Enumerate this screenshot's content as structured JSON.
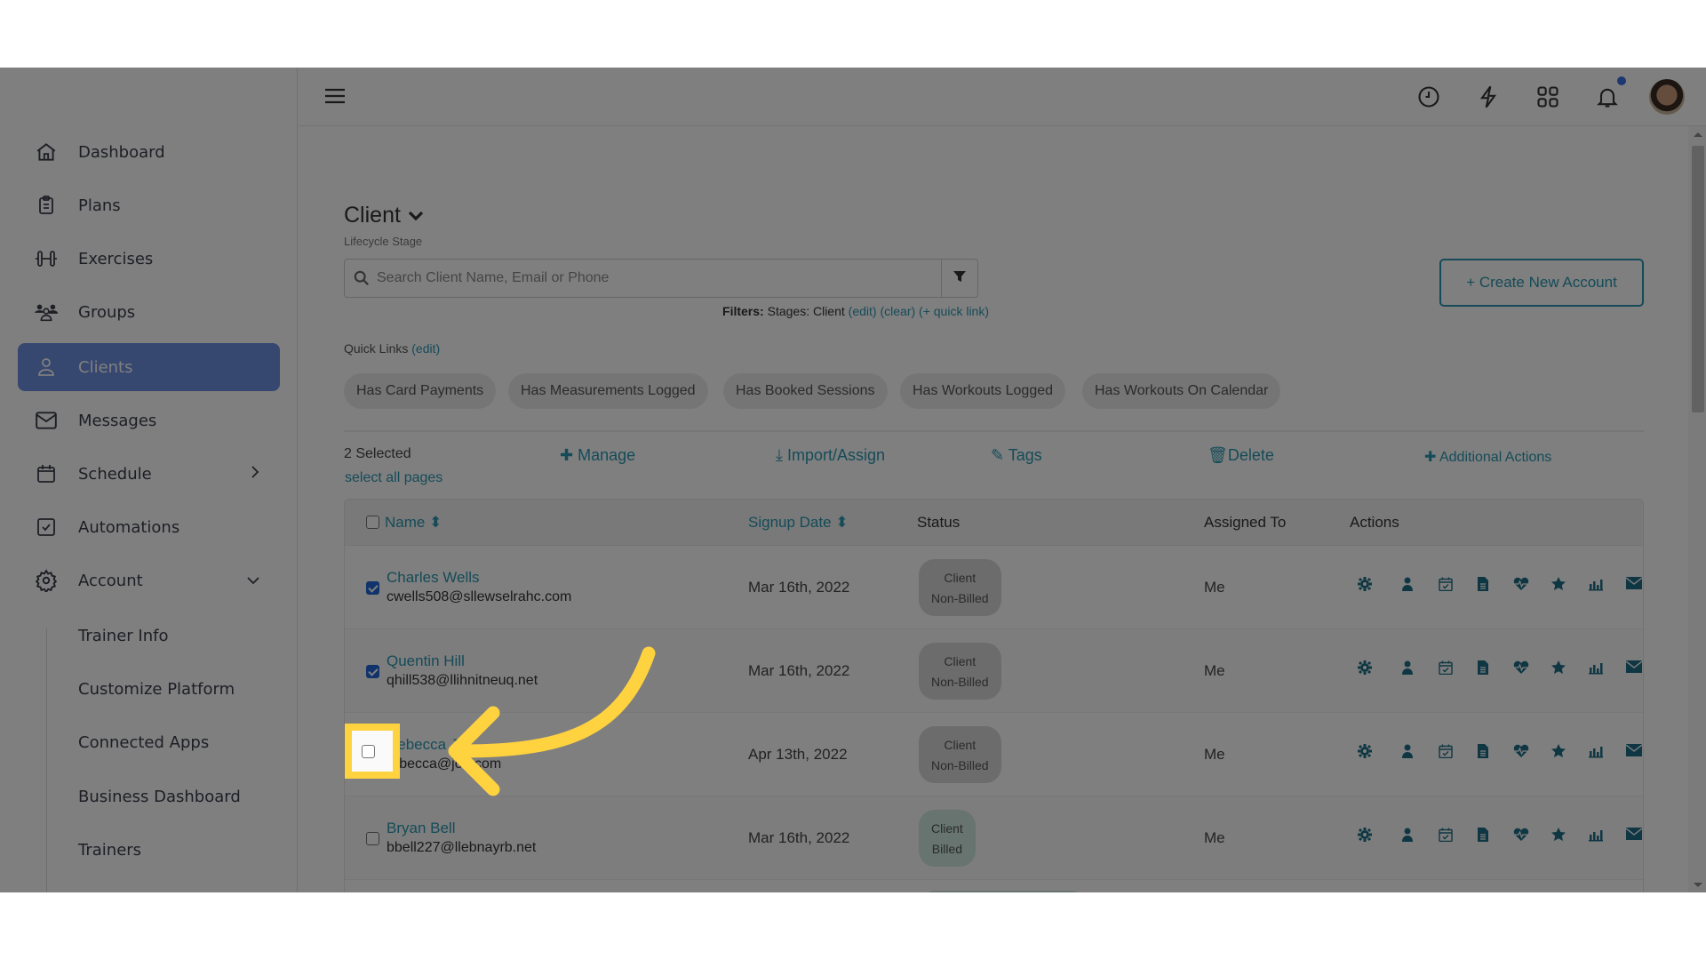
{
  "sidebar": {
    "items": [
      {
        "label": "Dashboard",
        "icon": "home-icon"
      },
      {
        "label": "Plans",
        "icon": "clipboard-icon"
      },
      {
        "label": "Exercises",
        "icon": "dumbbell-icon"
      },
      {
        "label": "Groups",
        "icon": "users-icon"
      },
      {
        "label": "Clients",
        "icon": "user-icon",
        "active": true
      },
      {
        "label": "Messages",
        "icon": "mail-icon"
      },
      {
        "label": "Schedule",
        "icon": "calendar-icon"
      },
      {
        "label": "Automations",
        "icon": "checkbox-icon"
      },
      {
        "label": "Account",
        "icon": "gear-icon"
      }
    ],
    "account_sub": [
      "Trainer Info",
      "Customize Platform",
      "Connected Apps",
      "Business Dashboard",
      "Trainers"
    ]
  },
  "topbar": {
    "icons": [
      "clock-icon",
      "lightning-icon",
      "apps-grid-icon",
      "bell-icon",
      "avatar"
    ],
    "notification_dot_color": "#3b6fe0"
  },
  "page": {
    "title": "Client",
    "subtitle": "Lifecycle Stage",
    "search_placeholder": "Search Client Name, Email or Phone",
    "filters": {
      "label": "Filters:",
      "text": "Stages: Client",
      "edit": "(edit)",
      "clear": "(clear)",
      "quick_link": "(+ quick link)"
    },
    "create_button": "+ Create New Account",
    "quick_links_label": "Quick Links",
    "quick_links_edit": "(edit)",
    "quick_links": [
      "Has Card Payments",
      "Has Measurements Logged",
      "Has Booked Sessions",
      "Has Workouts Logged",
      "Has Workouts On Calendar"
    ],
    "selected_count": "2 Selected",
    "select_all_pages": "select all pages",
    "bulk_actions": {
      "manage": "Manage",
      "import_assign": "Import/Assign",
      "tags": "Tags",
      "delete": "Delete",
      "additional": "Additional Actions"
    }
  },
  "table": {
    "headers": {
      "name": "Name",
      "signup_date": "Signup Date",
      "status": "Status",
      "assigned_to": "Assigned To",
      "actions": "Actions"
    },
    "action_icons": [
      "gear-icon",
      "user-icon",
      "calendar-check-icon",
      "document-icon",
      "heartbeat-icon",
      "star-icon",
      "bar-chart-icon",
      "envelope-icon"
    ],
    "rows": [
      {
        "name": "Charles Wells",
        "email": "cwells508@sllewselrahc.com",
        "signup_date": "Mar 16th, 2022",
        "status_line1": "Client",
        "status_line2": "Non-Billed",
        "assigned_to": "Me",
        "checked": true
      },
      {
        "name": "Quentin Hill",
        "email": "qhill538@llihnitneuq.net",
        "signup_date": "Mar 16th, 2022",
        "status_line1": "Client",
        "status_line2": "Non-Billed",
        "assigned_to": "Me",
        "checked": true
      },
      {
        "name": "Rebecca J",
        "email": "rebecca@jo...com",
        "signup_date": "Apr 13th, 2022",
        "status_line1": "Client",
        "status_line2": "Non-Billed",
        "assigned_to": "Me",
        "checked": false
      },
      {
        "name": "Bryan Bell",
        "email": "bbell227@llebnayrb.net",
        "signup_date": "Mar 16th, 2022",
        "status_line1": "Client",
        "status_line2": "Billed",
        "assigned_to": "Me",
        "checked": false
      }
    ]
  },
  "colors": {
    "accent": "#2a97b0",
    "active_nav": "#6d8ee0",
    "highlight": "#ffd23f",
    "checkbox_checked": "#2266d6"
  }
}
